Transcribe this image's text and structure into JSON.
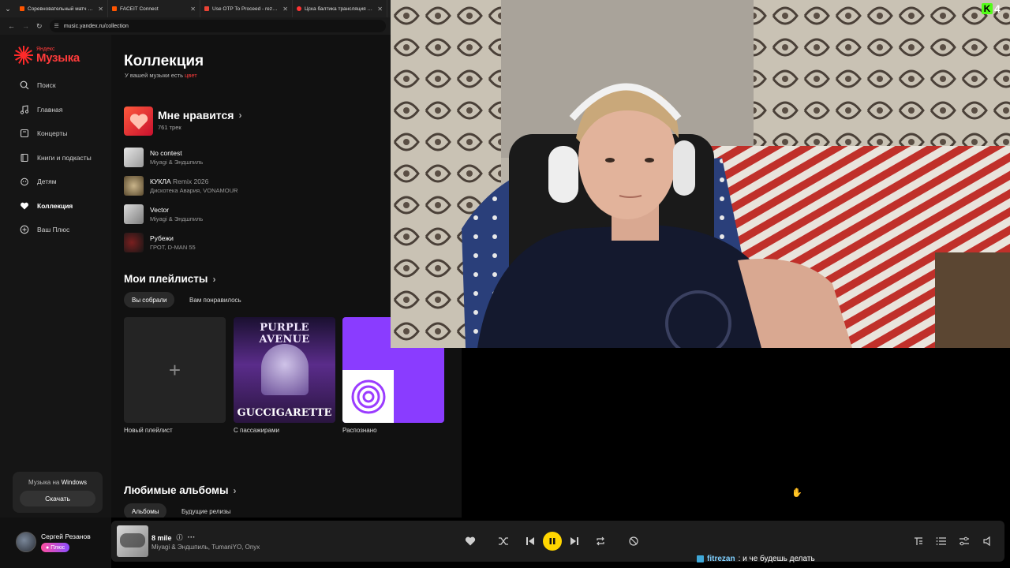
{
  "browser": {
    "tabs": [
      {
        "title": "Соревновательный матч FACEIT",
        "color": "#ff5500"
      },
      {
        "title": "FACEIT Connect",
        "color": "#ff5500"
      },
      {
        "title": "Use OTP To Proceed - rezanch",
        "color": "#ea4335"
      },
      {
        "title": "Цска балтика трансляция — Я",
        "color": "#ff3333"
      }
    ],
    "url": "music.yandex.ru/collection"
  },
  "sidebar": {
    "logo_small": "Яндекс",
    "logo_big": "Музыка",
    "items": [
      {
        "label": "Поиск",
        "icon": "search-icon"
      },
      {
        "label": "Главная",
        "icon": "music-note-icon"
      },
      {
        "label": "Концерты",
        "icon": "ticket-icon"
      },
      {
        "label": "Книги и подкасты",
        "icon": "book-icon"
      },
      {
        "label": "Детям",
        "icon": "kids-icon"
      },
      {
        "label": "Коллекция",
        "icon": "heart-icon"
      },
      {
        "label": "Ваш Плюс",
        "icon": "plus-icon"
      }
    ],
    "promo_prefix": "Музыка на",
    "promo_os": "Windows",
    "promo_button": "Скачать"
  },
  "collection": {
    "title": "Коллекция",
    "subtitle_prefix": "У вашей музыки есть",
    "subtitle_highlight": "цвет",
    "liked_title": "Мне нравится",
    "liked_count": "761 трек",
    "tracks": [
      {
        "title": "No contest",
        "remix": "",
        "artist": "Miyagi & Эндшпиль"
      },
      {
        "title": "КУКЛА",
        "remix": "Remix 2026",
        "artist": "Дискотека Авария, VONAMOUR"
      },
      {
        "title": "Vector",
        "remix": "",
        "artist": "Miyagi & Эндшпиль"
      },
      {
        "title": "Рубежи",
        "remix": "",
        "artist": "ГРОТ, D-MAN 55"
      }
    ],
    "playlists_title": "Мои плейлисты",
    "chips": [
      "Вы собрали",
      "Вам понравилось"
    ],
    "playlists": [
      {
        "label": "Новый плейлист"
      },
      {
        "label": "С пассажирами",
        "cover_top": "PURPLE AVENUE",
        "cover_bottom": "GUCCIGARETTE"
      },
      {
        "label": "Распознано"
      }
    ],
    "albums_title": "Любимые альбомы",
    "album_chips": [
      "Альбомы",
      "Будущие релизы"
    ]
  },
  "user": {
    "name": "Сергей Резанов",
    "plus": "Плюс"
  },
  "player": {
    "title": "8 mile",
    "artist": "Miyagi & Эндшпиль, TumaniYO, Onyx"
  },
  "chat": {
    "nick": "fitrezan",
    "message": ": и че будешь делать"
  },
  "overlay": {
    "kick_count": "4"
  },
  "colors": {
    "accent": "#ffd600",
    "brand": "#ff3b3b",
    "kick": "#53fc18"
  }
}
